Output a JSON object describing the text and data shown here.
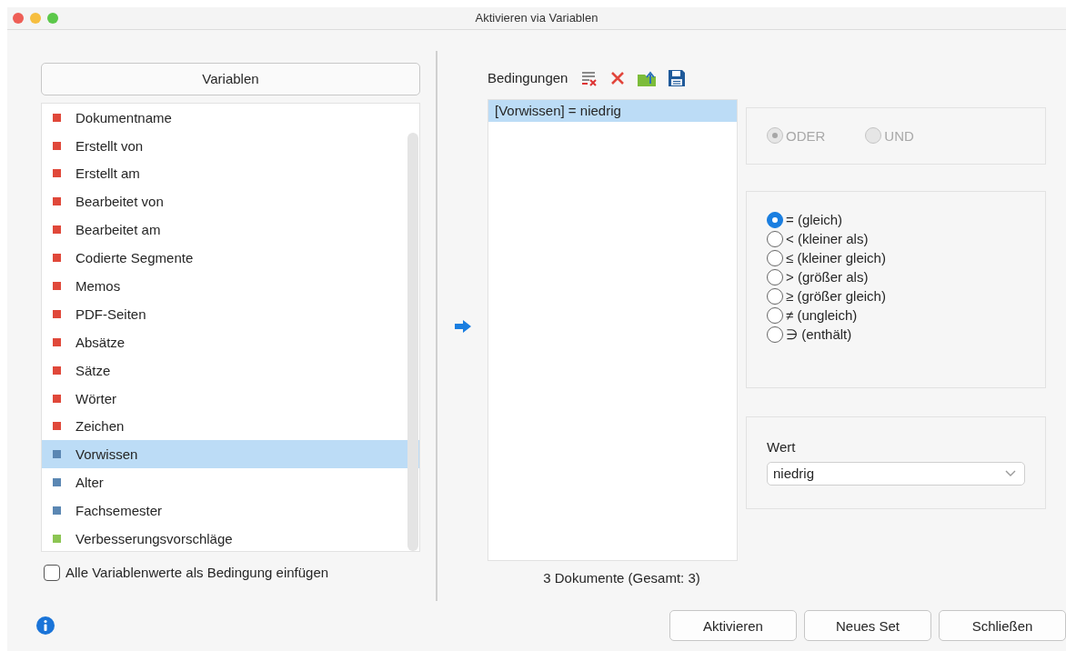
{
  "window": {
    "title": "Aktivieren via Variablen"
  },
  "variables": {
    "header": "Variablen",
    "items": [
      {
        "label": "Dokumentname",
        "color": "#e0483a",
        "selected": false
      },
      {
        "label": "Erstellt von",
        "color": "#e0483a",
        "selected": false
      },
      {
        "label": "Erstellt am",
        "color": "#e0483a",
        "selected": false
      },
      {
        "label": "Bearbeitet von",
        "color": "#e0483a",
        "selected": false
      },
      {
        "label": "Bearbeitet am",
        "color": "#e0483a",
        "selected": false
      },
      {
        "label": "Codierte Segmente",
        "color": "#e0483a",
        "selected": false
      },
      {
        "label": "Memos",
        "color": "#e0483a",
        "selected": false
      },
      {
        "label": "PDF-Seiten",
        "color": "#e0483a",
        "selected": false
      },
      {
        "label": "Absätze",
        "color": "#e0483a",
        "selected": false
      },
      {
        "label": "Sätze",
        "color": "#e0483a",
        "selected": false
      },
      {
        "label": "Wörter",
        "color": "#e0483a",
        "selected": false
      },
      {
        "label": "Zeichen",
        "color": "#e0483a",
        "selected": false
      },
      {
        "label": "Vorwissen",
        "color": "#5b87b3",
        "selected": true
      },
      {
        "label": "Alter",
        "color": "#5b87b3",
        "selected": false
      },
      {
        "label": "Fachsemester",
        "color": "#5b87b3",
        "selected": false
      },
      {
        "label": "Verbesserungsvorschläge",
        "color": "#8cc553",
        "selected": false
      }
    ],
    "insert_all": {
      "label": "Alle Variablenwerte als Bedingung einfügen",
      "checked": false
    }
  },
  "conditions": {
    "title": "Bedingungen",
    "items": [
      {
        "text": "[Vorwissen] = niedrig",
        "selected": true
      }
    ],
    "status": "3 Dokumente (Gesamt: 3)"
  },
  "logic": {
    "disabled": true,
    "options": [
      {
        "label": "ODER",
        "selected": true
      },
      {
        "label": "UND",
        "selected": false
      }
    ]
  },
  "operators": [
    {
      "label": "= (gleich)",
      "selected": true
    },
    {
      "label": "< (kleiner als)",
      "selected": false
    },
    {
      "label": "≤ (kleiner gleich)",
      "selected": false
    },
    {
      "label": "> (größer als)",
      "selected": false
    },
    {
      "label": "≥ (größer gleich)",
      "selected": false
    },
    {
      "label": "≠ (ungleich)",
      "selected": false
    },
    {
      "label": "∋ (enthält)",
      "selected": false
    }
  ],
  "value": {
    "label": "Wert",
    "value": "niedrig"
  },
  "buttons": [
    "Aktivieren",
    "Neues Set",
    "Schließen"
  ]
}
